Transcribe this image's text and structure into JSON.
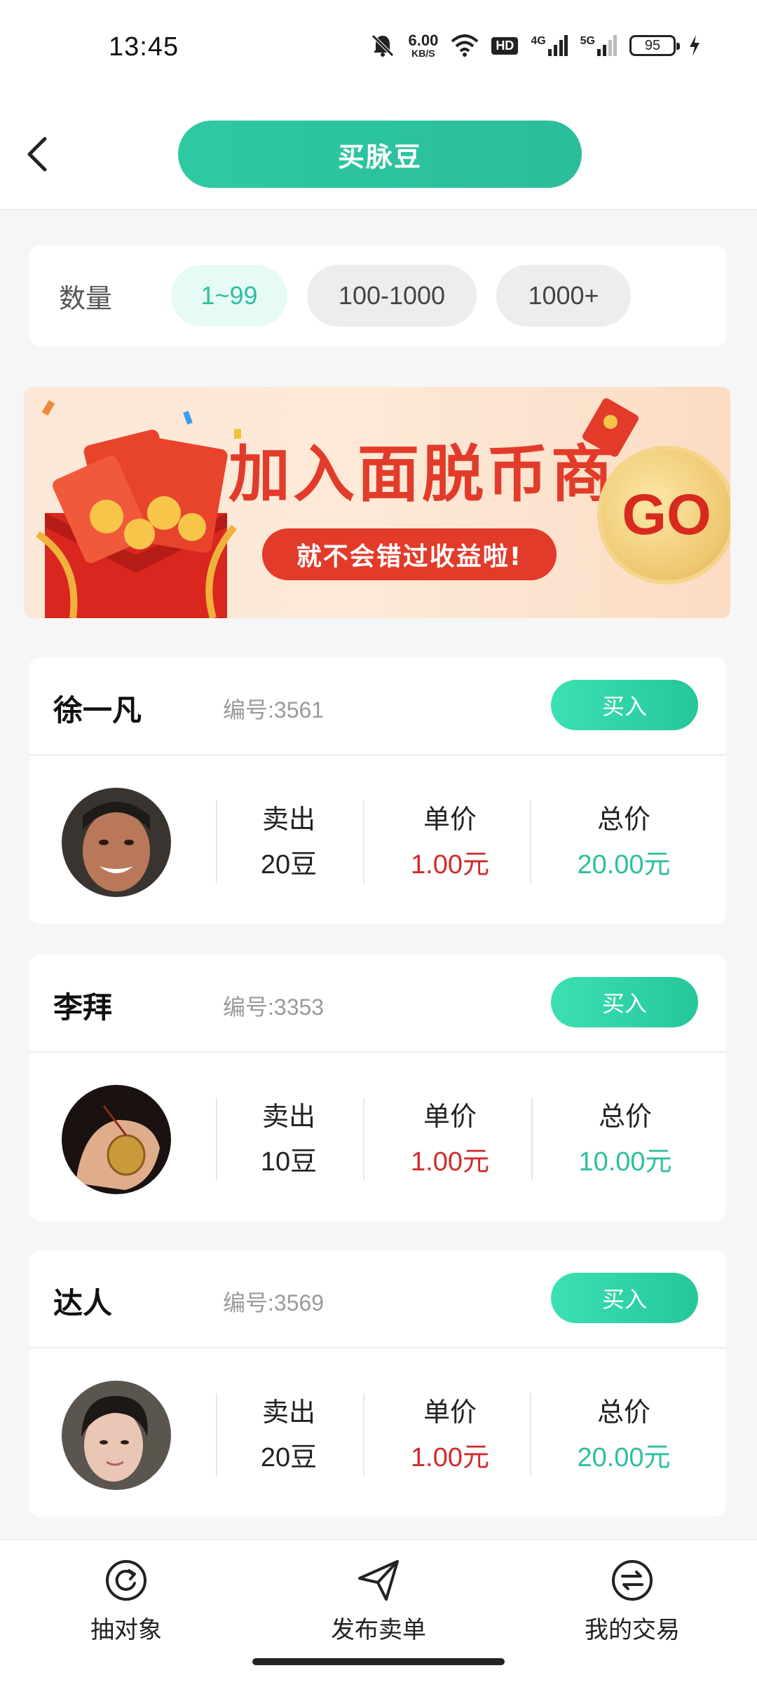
{
  "status": {
    "time": "13:45",
    "speed_value": "6.00",
    "speed_unit": "KB/S",
    "hd_label": "HD",
    "net1": "4G",
    "net2": "5G",
    "battery": "95"
  },
  "header": {
    "title": "买脉豆"
  },
  "filter": {
    "label": "数量",
    "chips": [
      "1~99",
      "100-1000",
      "1000+"
    ],
    "selected": "1~99"
  },
  "banner": {
    "headline": "加入面脱币商",
    "sub": "就不会错过收益啦!",
    "go": "GO"
  },
  "sellers": [
    {
      "name": "徐一凡",
      "id": "编号:3561",
      "buy": "买入",
      "sell_label": "卖出",
      "sell_value": "20豆",
      "price_label": "单价",
      "price_value": "1.00元",
      "total_label": "总价",
      "total_value": "20.00元"
    },
    {
      "name": "李拜",
      "id": "编号:3353",
      "buy": "买入",
      "sell_label": "卖出",
      "sell_value": "10豆",
      "price_label": "单价",
      "price_value": "1.00元",
      "total_label": "总价",
      "total_value": "10.00元"
    },
    {
      "name": "达人",
      "id": "编号:3569",
      "buy": "买入",
      "sell_label": "卖出",
      "sell_value": "20豆",
      "price_label": "单价",
      "price_value": "1.00元",
      "total_label": "总价",
      "total_value": "20.00元"
    }
  ],
  "nav": {
    "items": [
      {
        "label": "抽对象",
        "icon": "refresh-circle-icon"
      },
      {
        "label": "发布卖单",
        "icon": "paper-plane-icon"
      },
      {
        "label": "我的交易",
        "icon": "exchange-arrows-icon"
      }
    ]
  },
  "colors": {
    "accent": "#2dbf9f",
    "price_red": "#d32a2a",
    "banner_red": "#e23b2a"
  }
}
